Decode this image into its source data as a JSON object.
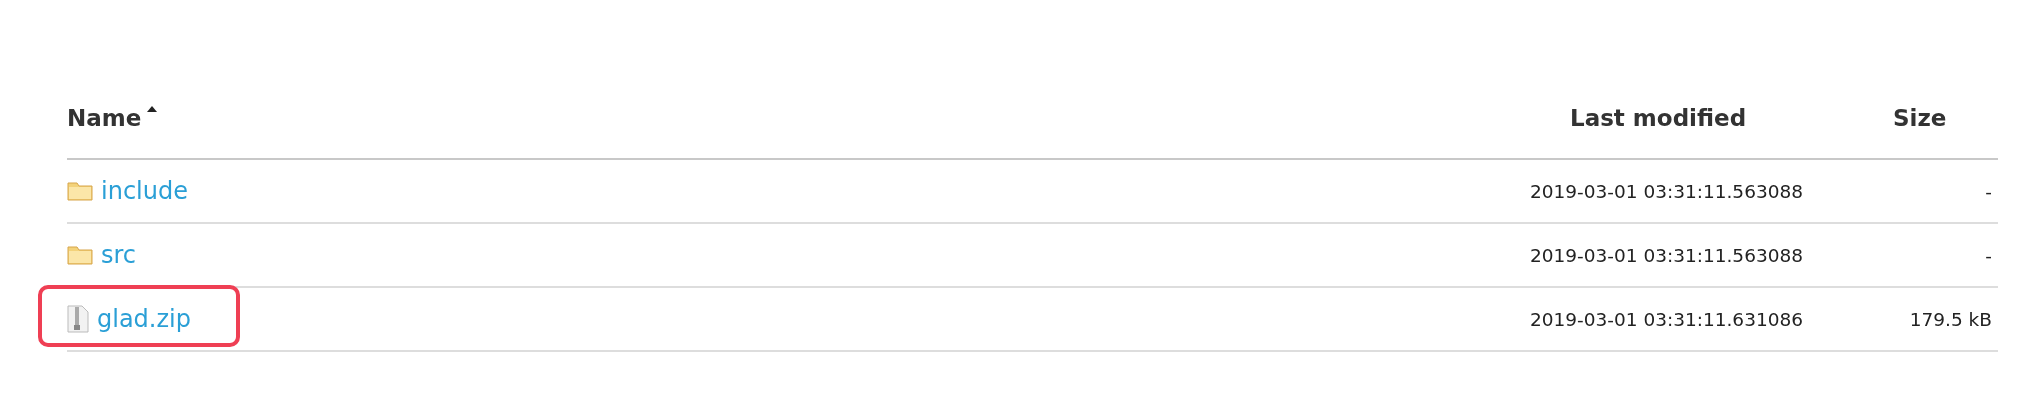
{
  "table": {
    "columns": [
      {
        "label": "Name",
        "sorted": true
      },
      {
        "label": "Last modified",
        "sorted": false
      },
      {
        "label": "Size",
        "sorted": false
      }
    ],
    "rows": [
      {
        "kind": "folder",
        "name": "include",
        "modified": "2019-03-01 03:31:11.563088",
        "size": "-",
        "highlighted": false
      },
      {
        "kind": "folder",
        "name": "src",
        "modified": "2019-03-01 03:31:11.563088",
        "size": "-",
        "highlighted": false
      },
      {
        "kind": "zip",
        "name": "glad.zip",
        "modified": "2019-03-01 03:31:11.631086",
        "size": "179.5 kB",
        "highlighted": true
      }
    ]
  }
}
